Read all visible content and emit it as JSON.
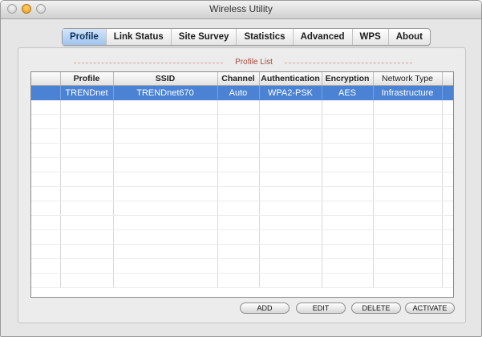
{
  "window": {
    "title": "Wireless Utility"
  },
  "tabs": [
    {
      "label": "Profile",
      "active": true
    },
    {
      "label": "Link Status"
    },
    {
      "label": "Site Survey"
    },
    {
      "label": "Statistics"
    },
    {
      "label": "Advanced"
    },
    {
      "label": "WPS"
    },
    {
      "label": "About"
    }
  ],
  "profile_list": {
    "title": "Profile List",
    "columns": [
      "",
      "Profile",
      "SSID",
      "Channel",
      "Authentication",
      "Encryption",
      "Network Type",
      ""
    ],
    "rows": [
      [
        "",
        "TRENDnet",
        "TRENDnet670",
        "Auto",
        "WPA2-PSK",
        "AES",
        "Infrastructure",
        ""
      ]
    ]
  },
  "buttons": {
    "add": "ADD",
    "edit": "EDIT",
    "delete": "DELETE",
    "activate": "ACTIVATE"
  },
  "colors": {
    "selection": "#4b82d4",
    "active_tab": "#9ec4ef",
    "list_title": "#a94b3b"
  }
}
